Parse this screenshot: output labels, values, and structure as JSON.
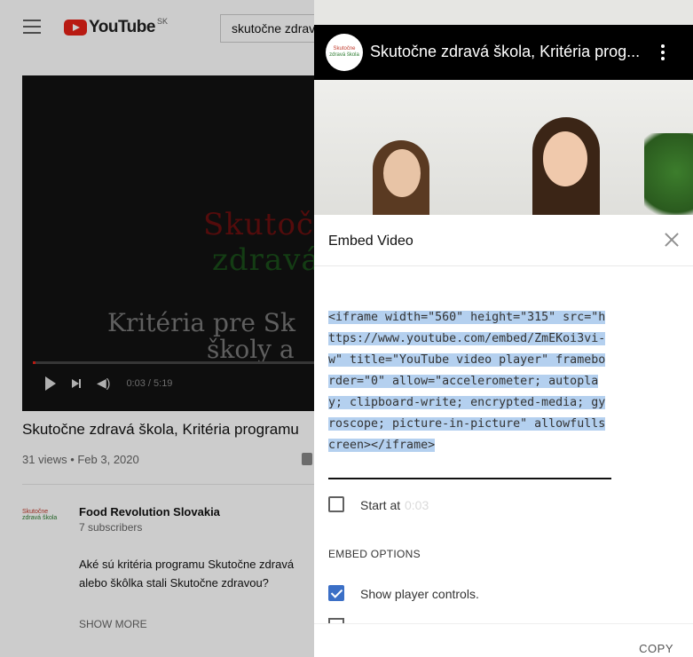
{
  "background": {
    "country": "SK",
    "search_value": "skutočne zdravá škola",
    "player": {
      "title_line1": "Skutočne",
      "title_line2": "zdravá",
      "subtitle_line1": "Kritéria pre Sk",
      "subtitle_line2": "školy a",
      "time": "0:03 / 5:19",
      "progress": 0.01
    },
    "video_title": "Skutočne zdravá škola, Kritéria programu",
    "views": "31 views • Feb 3, 2020",
    "channel": {
      "avatar_line1": "Skutočne",
      "avatar_line2": "zdravá škola",
      "name": "Food Revolution Slovakia",
      "subscribers": "7 subscribers"
    },
    "description_line1": "Aké sú kritéria programu Skutočne zdravá",
    "description_line2": "alebo škôlka stali Skutočne zdravou?",
    "show_more": "SHOW MORE"
  },
  "panel": {
    "preview": {
      "logo_line1": "Skutočne",
      "logo_line2": "zdravá škola",
      "title": "Skutočne zdravá škola, Kritéria prog..."
    },
    "embed_title": "Embed Video",
    "embed_code": "<iframe width=\"560\" height=\"315\" src=\"https://www.youtube.com/embed/ZmEKoi3vi-w\" title=\"YouTube video player\" frameborder=\"0\" allow=\"accelerometer; autoplay; clipboard-write; encrypted-media; gyroscope; picture-in-picture\" allowfullscreen></iframe>",
    "start_at_label": "Start at",
    "start_at_value": "0:03",
    "embed_options_label": "EMBED OPTIONS",
    "show_controls_label": "Show player controls.",
    "copy_label": "COPY"
  },
  "colors": {
    "youtube_red": "#e62117",
    "selection": "#b4d0ef",
    "checkbox_checked": "#3b6fc6"
  },
  "icons": [
    "menu-icon",
    "youtube-logo",
    "play-icon",
    "next-icon",
    "volume-icon",
    "like-icon",
    "kebab-menu-icon",
    "close-icon",
    "check-icon"
  ]
}
